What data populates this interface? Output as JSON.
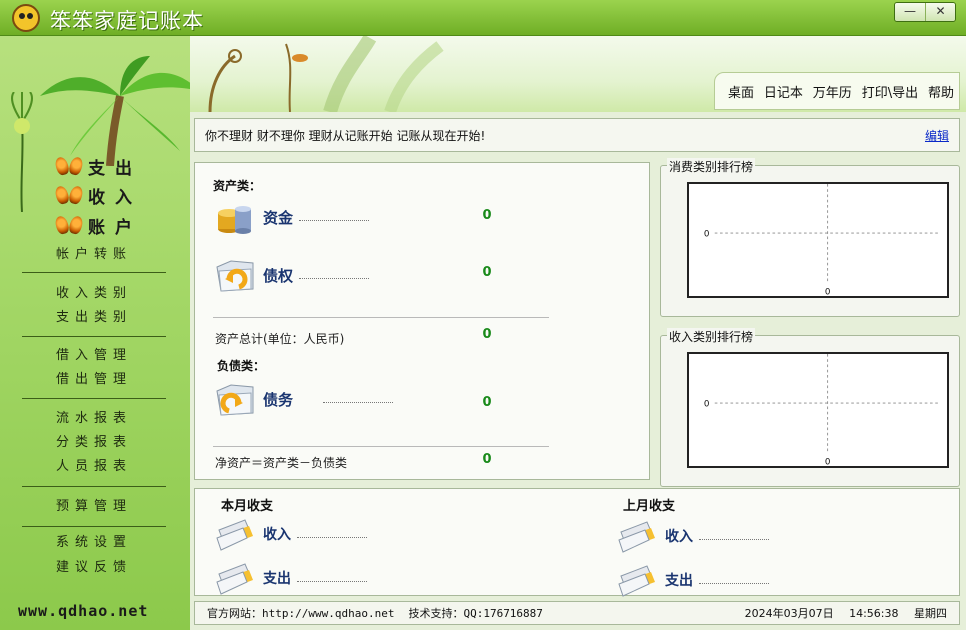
{
  "window": {
    "title": "笨笨家庭记账本",
    "minimize_label": "—",
    "close_label": "✕"
  },
  "sidebar": {
    "primary": [
      {
        "label": "支出"
      },
      {
        "label": "收入"
      },
      {
        "label": "账户"
      }
    ],
    "groups": [
      [
        "帐户转账"
      ],
      [
        "收入类别",
        "支出类别"
      ],
      [
        "借入管理",
        "借出管理"
      ],
      [
        "流水报表",
        "分类报表",
        "人员报表"
      ],
      [
        "预算管理"
      ],
      [
        "系统设置",
        "建议反馈"
      ]
    ],
    "site_url": "www.qdhao.net"
  },
  "topnav": [
    "桌面",
    "日记本",
    "万年历",
    "打印\\导出",
    "帮助"
  ],
  "slogan": {
    "text": "你不理财  财不理你  理财从记账开始  记账从现在开始!",
    "edit_label": "编辑"
  },
  "assets": {
    "section_title": "资产类：",
    "items": [
      {
        "name": "资金",
        "value": "0",
        "icon": "coins-icon"
      },
      {
        "name": "债权",
        "value": "0",
        "icon": "folder-arrow-icon"
      }
    ],
    "total_label": "资产总计(单位：人民币)",
    "total_value": "0"
  },
  "liabilities": {
    "section_title": "负债类：",
    "items": [
      {
        "name": "债务",
        "value": "0",
        "icon": "folder-arrow-icon"
      }
    ],
    "net_label": "净资产＝资产类－负债类",
    "net_value": "0"
  },
  "rankings": {
    "expense_title": "消费类别排行榜",
    "income_title": "收入类别排行榜"
  },
  "chart_data": [
    {
      "type": "bar",
      "title": "消费类别排行榜",
      "x": [
        0
      ],
      "y": [
        0
      ],
      "xlabel": "",
      "ylabel": "",
      "xtick": "0",
      "ytick": "0",
      "grid": true
    },
    {
      "type": "bar",
      "title": "收入类别排行榜",
      "x": [
        0
      ],
      "y": [
        0
      ],
      "xlabel": "",
      "ylabel": "",
      "xtick": "0",
      "ytick": "0",
      "grid": true
    }
  ],
  "monthly": {
    "this_month_title": "本月收支",
    "last_month_title": "上月收支",
    "income_label": "收入",
    "expense_label": "支出"
  },
  "status": {
    "website_label": "官方网站：",
    "website_url": "http://www.qdhao.net",
    "support_label": "技术支持：",
    "support_qq": "QQ:176716887",
    "date": "2024年03月07日",
    "time": "14:56:38",
    "weekday": "星期四"
  },
  "colors": {
    "value_green": "#198a1a",
    "name_blue": "#1a3570",
    "link_blue": "#0a29c8",
    "sidebar_green": "#a5d868"
  }
}
